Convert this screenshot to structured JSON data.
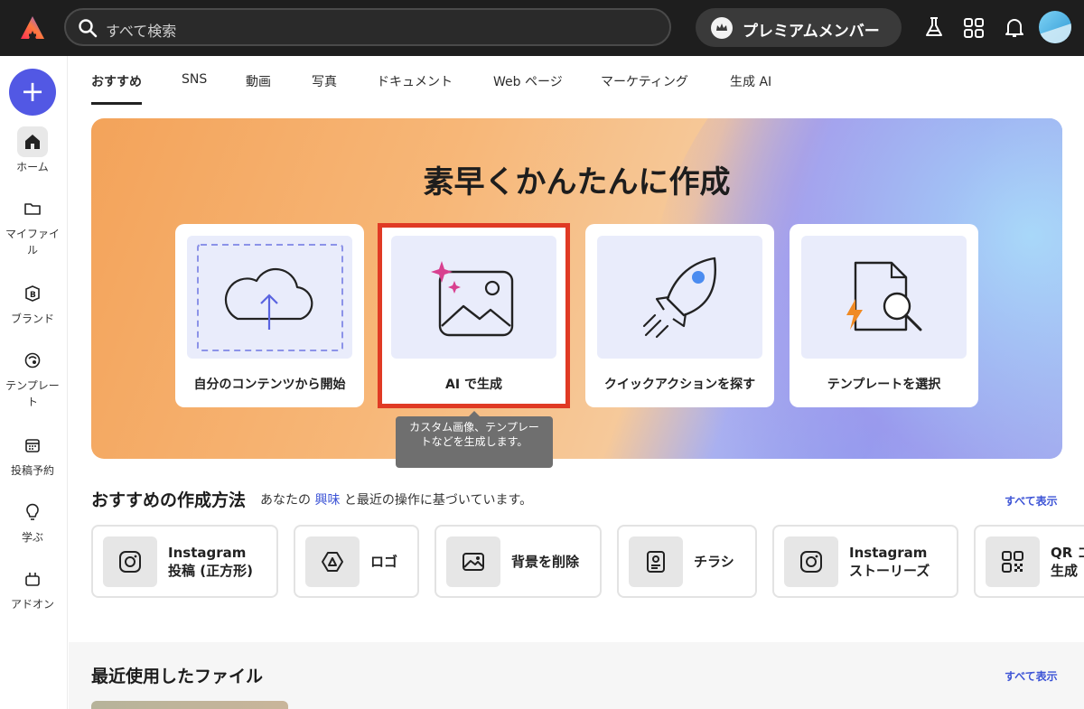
{
  "topbar": {
    "search_placeholder": "すべて検索",
    "premium_label": "プレミアムメンバー",
    "icons": [
      "flask-icon",
      "apps-grid-icon",
      "bell-icon"
    ]
  },
  "rail": {
    "items": [
      {
        "label": "ホーム",
        "icon": "home-icon"
      },
      {
        "label": "マイファイル",
        "icon": "folder-icon"
      },
      {
        "label": "ブランド",
        "icon": "brand-icon"
      },
      {
        "label": "テンプレート",
        "icon": "template-icon"
      },
      {
        "label": "投稿予約",
        "icon": "calendar-icon"
      },
      {
        "label": "学ぶ",
        "icon": "lightbulb-icon"
      },
      {
        "label": "アドオン",
        "icon": "addon-icon"
      }
    ]
  },
  "tabs": [
    "おすすめ",
    "SNS",
    "動画",
    "写真",
    "ドキュメント",
    "Web ページ",
    "マーケティング",
    "生成 AI"
  ],
  "hero": {
    "title": "素早くかんたんに作成",
    "cards": [
      {
        "label": "自分のコンテンツから開始"
      },
      {
        "label": "AI で生成"
      },
      {
        "label": "クイックアクションを探す"
      },
      {
        "label": "テンプレートを選択"
      }
    ],
    "tooltip": "カスタム画像、テンプレートなどを生成します。"
  },
  "recommended": {
    "title": "おすすめの作成方法",
    "subtitle_pre": "あなたの",
    "subtitle_link": "興味",
    "subtitle_post": "と最近の操作に基づいています。",
    "see_all": "すべて表示",
    "chips": [
      {
        "line1": "Instagram",
        "line2": "投稿 (正方形)",
        "icon": "instagram-icon"
      },
      {
        "line1": "ロゴ",
        "line2": "",
        "icon": "logo-icon"
      },
      {
        "line1": "背景を削除",
        "line2": "",
        "icon": "image-icon"
      },
      {
        "line1": "チラシ",
        "line2": "",
        "icon": "flyer-icon"
      },
      {
        "line1": "Instagram",
        "line2": "ストーリーズ",
        "icon": "instagram-icon"
      },
      {
        "line1": "QR コ",
        "line2": "生成",
        "icon": "qr-icon"
      }
    ]
  },
  "recent": {
    "title": "最近使用したファイル",
    "see_all": "すべて表示"
  },
  "colors": {
    "topbar": "#1e1e1e",
    "accent": "#5258e4",
    "link": "#3d54d6",
    "highlight": "#e03a24"
  }
}
